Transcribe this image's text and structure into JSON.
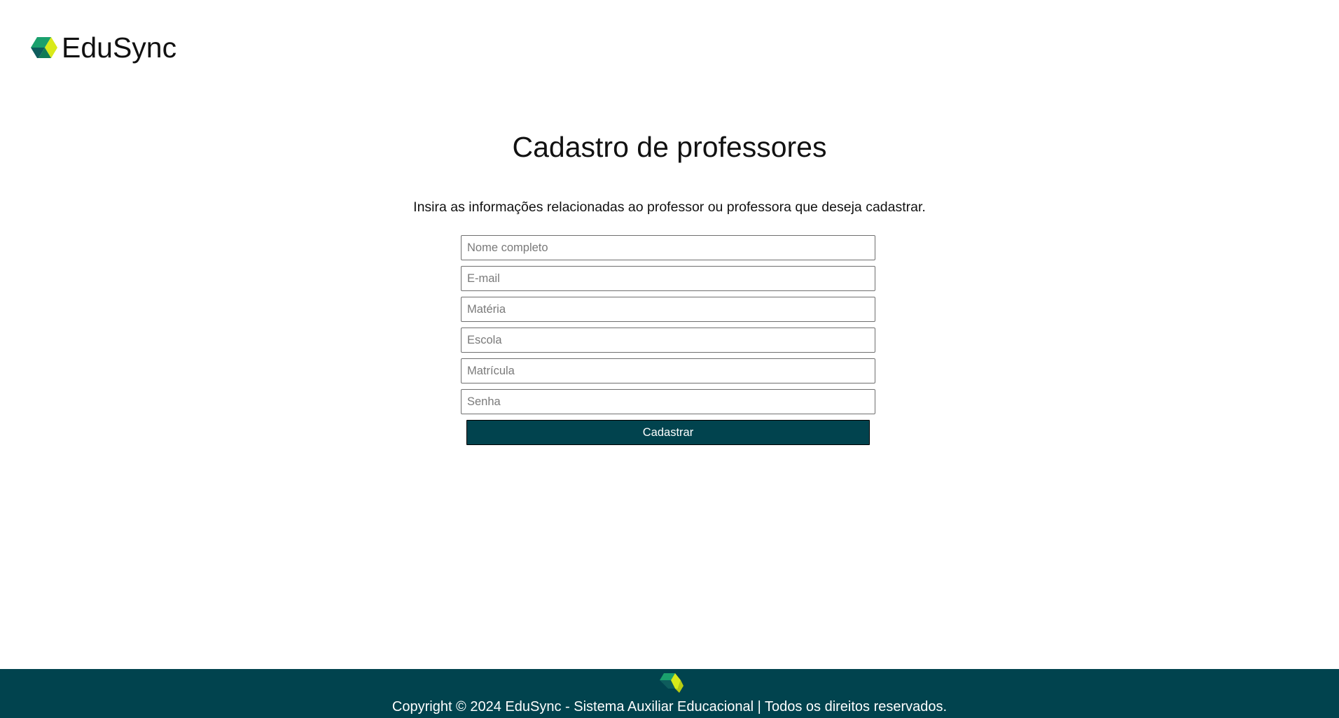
{
  "header": {
    "brand": "EduSync",
    "logo_icon": "edusync-logo-icon"
  },
  "main": {
    "title": "Cadastro de professores",
    "subtitle": "Insira as informações relacionadas ao professor ou professora que deseja cadastrar."
  },
  "form": {
    "fields": [
      {
        "placeholder": "Nome completo",
        "value": ""
      },
      {
        "placeholder": "E-mail",
        "value": ""
      },
      {
        "placeholder": "Matéria",
        "value": ""
      },
      {
        "placeholder": "Escola",
        "value": ""
      },
      {
        "placeholder": "Matrícula",
        "value": ""
      },
      {
        "placeholder": "Senha",
        "value": ""
      }
    ],
    "submit_label": "Cadastrar"
  },
  "footer": {
    "text": "Copyright © 2024 EduSync - Sistema Auxiliar Educacional | Todos os direitos reservados.",
    "logo_icon": "edusync-logo-icon"
  },
  "colors": {
    "primary": "#01434e",
    "logo_dark": "#0e5c5c",
    "logo_green": "#1aa06d",
    "logo_yellow": "#d9ea1a",
    "background": "#ffffff"
  }
}
